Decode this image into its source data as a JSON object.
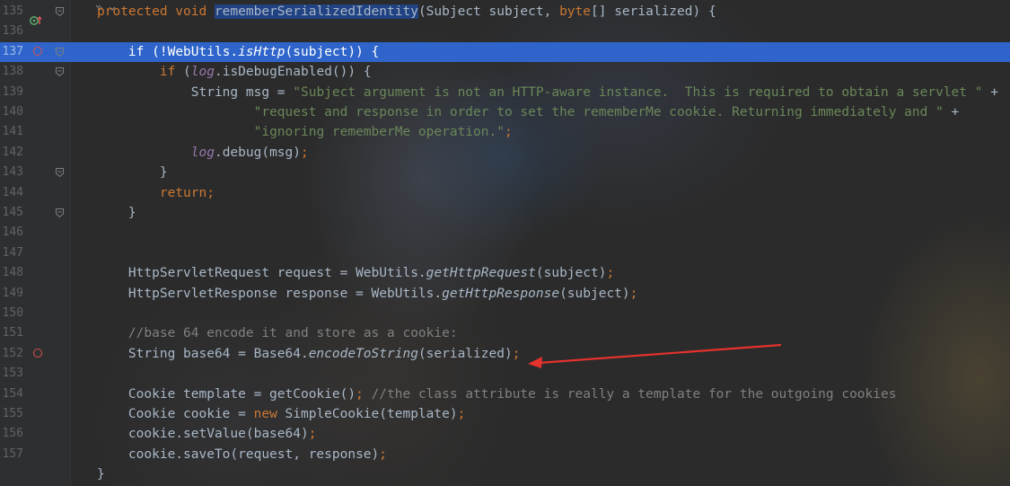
{
  "editor": {
    "lines": [
      {
        "num": "135",
        "segments": [
          {
            "t": "protected void ",
            "c": "kw"
          },
          {
            "t": "rememberSerializedIdentity",
            "c": "sel"
          },
          {
            "t": "(Subject subject, ",
            "c": ""
          },
          {
            "t": "byte",
            "c": "kw"
          },
          {
            "t": "[] serialized) {",
            "c": ""
          }
        ]
      },
      {
        "num": "136",
        "segments": []
      },
      {
        "num": "137",
        "segments": [
          {
            "t": "    ",
            "c": ""
          },
          {
            "t": "if ",
            "c": "kw"
          },
          {
            "t": "(!WebUtils.",
            "c": ""
          },
          {
            "t": "isHttp",
            "c": "stat"
          },
          {
            "t": "(subject)) {",
            "c": ""
          }
        ]
      },
      {
        "num": "138",
        "segments": [
          {
            "t": "        ",
            "c": ""
          },
          {
            "t": "if ",
            "c": "kw"
          },
          {
            "t": "(",
            "c": ""
          },
          {
            "t": "log",
            "c": "fld"
          },
          {
            "t": ".isDebugEnabled()) {",
            "c": ""
          }
        ]
      },
      {
        "num": "139",
        "segments": [
          {
            "t": "            String msg = ",
            "c": ""
          },
          {
            "t": "\"Subject argument is not an HTTP-aware instance.  This is required to obtain a servlet \"",
            "c": "str"
          },
          {
            "t": " +",
            "c": ""
          }
        ]
      },
      {
        "num": "140",
        "segments": [
          {
            "t": "                    ",
            "c": ""
          },
          {
            "t": "\"request and response in order to set the rememberMe cookie. Returning immediately and \"",
            "c": "str"
          },
          {
            "t": " +",
            "c": ""
          }
        ]
      },
      {
        "num": "141",
        "segments": [
          {
            "t": "                    ",
            "c": ""
          },
          {
            "t": "\"ignoring rememberMe operation.\"",
            "c": "str"
          },
          {
            "t": ";",
            "c": "kw"
          }
        ]
      },
      {
        "num": "142",
        "segments": [
          {
            "t": "            ",
            "c": ""
          },
          {
            "t": "log",
            "c": "fld"
          },
          {
            "t": ".debug(msg)",
            "c": ""
          },
          {
            "t": ";",
            "c": "kw"
          }
        ]
      },
      {
        "num": "143",
        "segments": [
          {
            "t": "        }",
            "c": ""
          }
        ]
      },
      {
        "num": "144",
        "segments": [
          {
            "t": "        ",
            "c": ""
          },
          {
            "t": "return;",
            "c": "kw"
          }
        ]
      },
      {
        "num": "145",
        "segments": [
          {
            "t": "    }",
            "c": ""
          }
        ]
      },
      {
        "num": "146",
        "segments": []
      },
      {
        "num": "147",
        "segments": []
      },
      {
        "num": "148",
        "segments": [
          {
            "t": "    HttpServletRequest request = WebUtils.",
            "c": ""
          },
          {
            "t": "getHttpRequest",
            "c": "stat"
          },
          {
            "t": "(subject)",
            "c": ""
          },
          {
            "t": ";",
            "c": "kw"
          }
        ]
      },
      {
        "num": "149",
        "segments": [
          {
            "t": "    HttpServletResponse response = WebUtils.",
            "c": ""
          },
          {
            "t": "getHttpResponse",
            "c": "stat"
          },
          {
            "t": "(subject)",
            "c": ""
          },
          {
            "t": ";",
            "c": "kw"
          }
        ]
      },
      {
        "num": "150",
        "segments": []
      },
      {
        "num": "151",
        "segments": [
          {
            "t": "    ",
            "c": ""
          },
          {
            "t": "//base 64 encode it and store as a cookie:",
            "c": "cmt"
          }
        ]
      },
      {
        "num": "152",
        "segments": [
          {
            "t": "    String base64 = Base64.",
            "c": ""
          },
          {
            "t": "encodeToString",
            "c": "stat"
          },
          {
            "t": "(serialized)",
            "c": ""
          },
          {
            "t": ";",
            "c": "kw"
          }
        ]
      },
      {
        "num": "153",
        "segments": []
      },
      {
        "num": "154",
        "segments": [
          {
            "t": "    Cookie template = getCookie()",
            "c": ""
          },
          {
            "t": "; ",
            "c": "kw"
          },
          {
            "t": "//the class attribute is really a template for the outgoing cookies",
            "c": "cmt"
          }
        ]
      },
      {
        "num": "155",
        "segments": [
          {
            "t": "    Cookie cookie = ",
            "c": ""
          },
          {
            "t": "new ",
            "c": "kw"
          },
          {
            "t": "SimpleCookie(template)",
            "c": ""
          },
          {
            "t": ";",
            "c": "kw"
          }
        ]
      },
      {
        "num": "156",
        "segments": [
          {
            "t": "    cookie.setValue(base64)",
            "c": ""
          },
          {
            "t": ";",
            "c": "kw"
          }
        ]
      },
      {
        "num": "157",
        "segments": [
          {
            "t": "    cookie.saveTo(request, response)",
            "c": ""
          },
          {
            "t": ";",
            "c": "kw"
          }
        ]
      },
      {
        "num": "",
        "segments": [
          {
            "t": "}",
            "c": ""
          }
        ]
      }
    ],
    "highlighted_line": "137",
    "breakpoint_lines": [
      "137",
      "152"
    ],
    "fold_lines": [
      "135",
      "137",
      "138",
      "143",
      "145"
    ]
  },
  "icons": {
    "override": "override-gutter-icon",
    "breakpoint": "breakpoint-icon",
    "fold": "fold-icon"
  },
  "colors": {
    "background": "#2b2b2b",
    "highlight": "#2f65ca",
    "keyword": "#cc7832",
    "string": "#6a8759",
    "comment": "#808080",
    "field": "#9876aa",
    "annotation_arrow": "#e5322d"
  }
}
